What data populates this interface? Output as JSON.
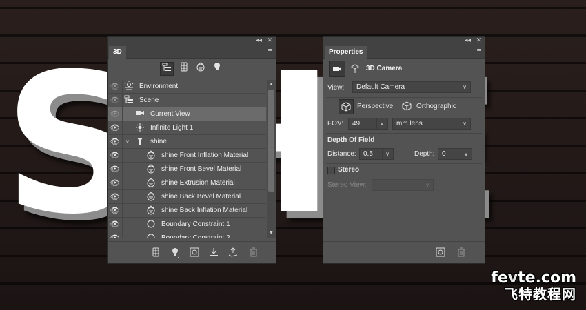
{
  "background": {
    "wall_text": "SHE"
  },
  "watermark": {
    "top_text_a": "fe",
    "top_text_v": "v",
    "top_text_b": "te.com",
    "bottom_text": "飞特教程网"
  },
  "panel_3d": {
    "tab_label": "3D",
    "topbar": {
      "collapse": "◂◂",
      "close": "✕"
    },
    "filters": [
      {
        "icon": "scene-filter-icon",
        "active": true
      },
      {
        "icon": "mesh-filter-icon",
        "active": false
      },
      {
        "icon": "material-filter-icon",
        "active": false
      },
      {
        "icon": "light-filter-icon",
        "active": false
      }
    ],
    "layers": [
      {
        "label": "Environment",
        "icon": "environment-icon",
        "visible_state": "dim",
        "indent": 0
      },
      {
        "label": "Scene",
        "icon": "scene-icon",
        "visible_state": "dim",
        "indent": 0
      },
      {
        "label": "Current View",
        "icon": "camera-icon",
        "visible_state": "dim",
        "indent": 1,
        "selected": true
      },
      {
        "label": "Infinite Light 1",
        "icon": "light-icon",
        "visible_state": "on",
        "indent": 1
      },
      {
        "label": "shine",
        "icon": "mesh-icon",
        "visible_state": "on",
        "indent": 1,
        "expanded": true
      },
      {
        "label": "shine Front Inflation Material",
        "icon": "material-icon",
        "visible_state": "on",
        "indent": 2
      },
      {
        "label": "shine Front Bevel Material",
        "icon": "material-icon",
        "visible_state": "on",
        "indent": 2
      },
      {
        "label": "shine Extrusion Material",
        "icon": "material-icon",
        "visible_state": "on",
        "indent": 2
      },
      {
        "label": "shine Back Bevel Material",
        "icon": "material-icon",
        "visible_state": "on",
        "indent": 2
      },
      {
        "label": "shine Back Inflation Material",
        "icon": "material-icon",
        "visible_state": "on",
        "indent": 2
      },
      {
        "label": "Boundary Constraint 1",
        "icon": "constraint-icon",
        "visible_state": "on",
        "indent": 2
      },
      {
        "label": "Boundary Constraint 2",
        "icon": "constraint-icon",
        "visible_state": "on",
        "indent": 2
      }
    ],
    "bottom_buttons": [
      "new-mesh-icon",
      "add-light-icon",
      "render-icon",
      "ground-plane-icon",
      "new-object-icon",
      "trash-icon"
    ]
  },
  "panel_props": {
    "tab_label": "Properties",
    "topbar": {
      "collapse": "◂◂",
      "close": "✕"
    },
    "title": "3D Camera",
    "view": {
      "label": "View:",
      "value": "Default Camera"
    },
    "perspective_label": "Perspective",
    "orthographic_label": "Orthographic",
    "fov": {
      "label": "FOV:",
      "value": "49",
      "unit": "mm lens"
    },
    "depth_of_field": {
      "heading": "Depth Of Field",
      "distance_label": "Distance:",
      "distance_value": "0.5",
      "depth_label": "Depth:",
      "depth_value": "0"
    },
    "stereo": {
      "label": "Stereo",
      "checked": false,
      "view_label": "Stereo View:",
      "view_value": ""
    }
  },
  "colors": {
    "panel_bg": "#535353",
    "panel_header": "#424242",
    "selected_row": "#6b6b6b",
    "text": "#e0e0e0"
  }
}
